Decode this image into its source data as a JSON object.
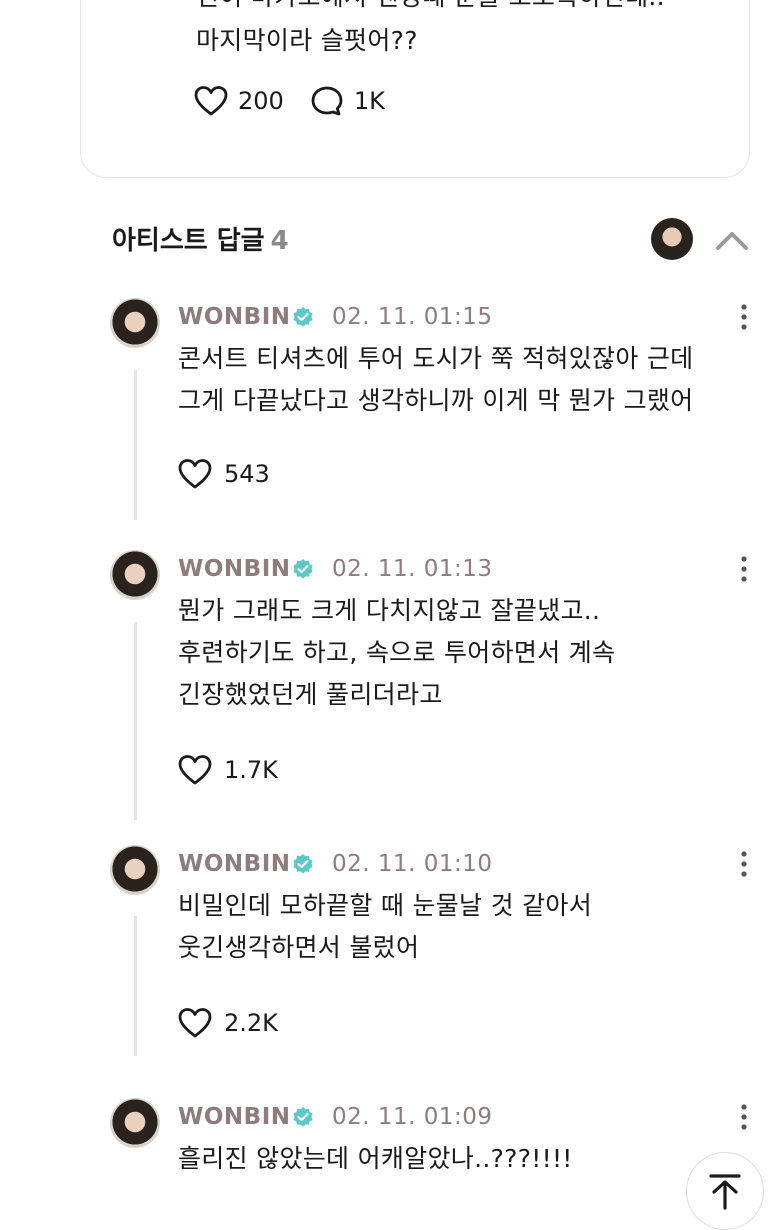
{
  "post": {
    "text_line1": "빈이 마카오에서 엔딩때 눈물 또로록하던데..",
    "text_line2": "마지막이라 슬펏어??",
    "like_count": "200",
    "comment_count": "1K"
  },
  "section": {
    "title": "아티스트 답글",
    "count": "4"
  },
  "comments": [
    {
      "author": "WONBIN",
      "time": "02. 11. 01:15",
      "lines": [
        "콘서트 티셔츠에 투어 도시가 쭉 적혀있잖아 근데",
        "그게 다끝났다고 생각하니까 이게 막 뭔가 그랬어"
      ],
      "likes": "543"
    },
    {
      "author": "WONBIN",
      "time": "02. 11. 01:13",
      "lines": [
        "뭔가 그래도 크게 다치지않고 잘끝냈고..",
        "후련하기도 하고, 속으로 투어하면서 계속",
        "긴장했었던게 풀리더라고"
      ],
      "likes": "1.7K"
    },
    {
      "author": "WONBIN",
      "time": "02. 11. 01:10",
      "lines": [
        "비밀인데 모하끝할 때 눈물날 것 같아서",
        "웃긴생각하면서 불렀어"
      ],
      "likes": "2.2K"
    },
    {
      "author": "WONBIN",
      "time": "02. 11. 01:09",
      "lines": [
        "흘리진 않았는데 어캐알았나..???!!!!"
      ]
    }
  ],
  "colors": {
    "accent_verified": "#5ec8c8",
    "author": "#8e7c7c"
  },
  "icons": [
    "heart-icon",
    "comment-bubble-icon",
    "chevron-up-icon",
    "verified-badge-icon",
    "more-vertical-icon",
    "scroll-to-top-icon"
  ]
}
